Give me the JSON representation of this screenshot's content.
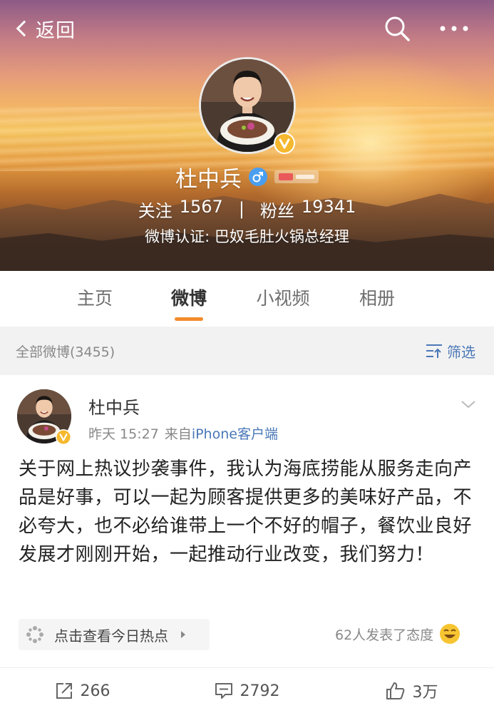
{
  "nav": {
    "back_label": "返回"
  },
  "profile": {
    "name": "杜中兵",
    "following_label": "关注",
    "following_count": "1567",
    "separator": "|",
    "followers_label": "粉丝",
    "followers_count": "19341",
    "verification": "微博认证: 巴奴毛肚火锅总经理"
  },
  "tabs": [
    {
      "label": "主页",
      "active": false
    },
    {
      "label": "微博",
      "active": true
    },
    {
      "label": "小视频",
      "active": false
    },
    {
      "label": "相册",
      "active": false
    }
  ],
  "filter": {
    "count_label": "全部微博(3455)",
    "button_label": "筛选"
  },
  "post": {
    "author": "杜中兵",
    "time": "昨天 15:27",
    "source_prefix": "来自",
    "source": "iPhone客户端",
    "text": "关于网上热议抄袭事件，我认为海底捞能从服务走向产品是好事，可以一起为顾客提供更多的美味好产品，不必夸大，也不必给谁带上一个不好的帽子，餐饮业良好发展才刚刚开始，一起推动行业改变，我们努力！",
    "hot_label": "点击查看今日热点",
    "reactions_label": "62人发表了态度",
    "repost_count": "266",
    "comment_count": "2792",
    "like_count": "3万"
  },
  "colors": {
    "accent": "#f38b2c",
    "link": "#4a78b7",
    "verified": "#f5b82e"
  },
  "icons": [
    "back-chevron-icon",
    "search-icon",
    "more-icon",
    "verified-icon",
    "male-icon",
    "filter-icon",
    "chevron-down-icon",
    "hot-spark-icon",
    "laugh-emoji-icon",
    "repost-icon",
    "comment-icon",
    "like-icon"
  ]
}
